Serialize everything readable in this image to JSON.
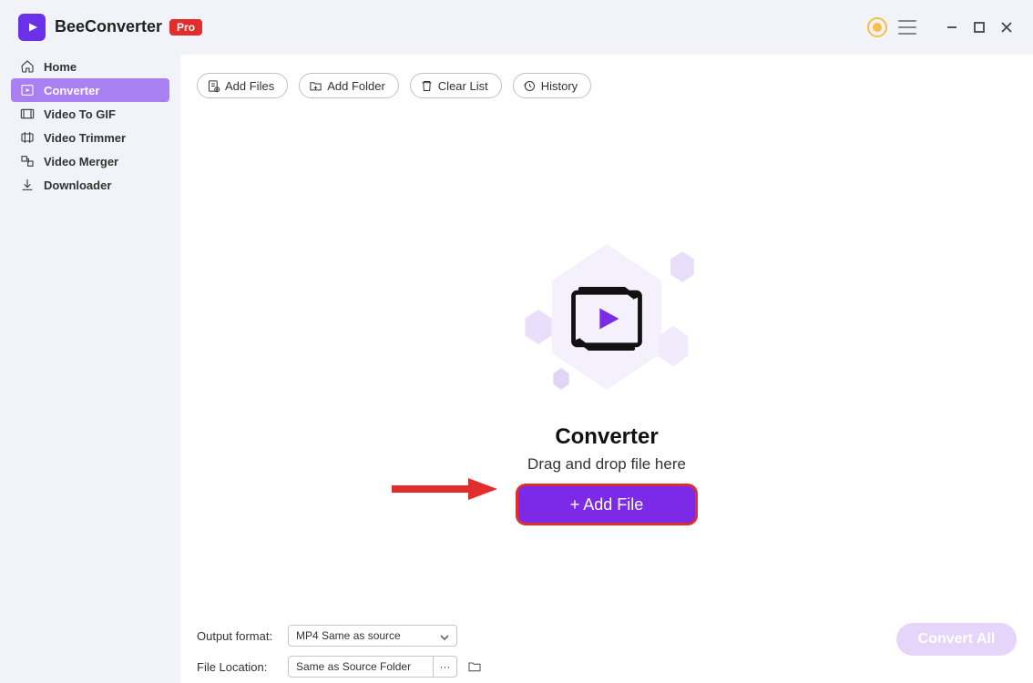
{
  "header": {
    "app_name": "BeeConverter",
    "pro_badge": "Pro"
  },
  "sidebar": {
    "items": [
      {
        "label": "Home"
      },
      {
        "label": "Converter"
      },
      {
        "label": "Video To GIF"
      },
      {
        "label": "Video Trimmer"
      },
      {
        "label": "Video Merger"
      },
      {
        "label": "Downloader"
      }
    ],
    "active_index": 1
  },
  "toolbar": {
    "add_files": "Add Files",
    "add_folder": "Add Folder",
    "clear_list": "Clear List",
    "history": "History"
  },
  "hero": {
    "title": "Converter",
    "subtitle": "Drag and drop file here",
    "add_file": "+ Add File"
  },
  "bottom": {
    "output_format_label": "Output format:",
    "output_format_value": "MP4 Same as source",
    "file_location_label": "File Location:",
    "file_location_value": "Same as Source Folder",
    "more": "···",
    "convert_all": "Convert All"
  },
  "colors": {
    "accent": "#7c29e8",
    "annotation": "#e22d2d",
    "sidebar_active": "#a97ff1"
  }
}
